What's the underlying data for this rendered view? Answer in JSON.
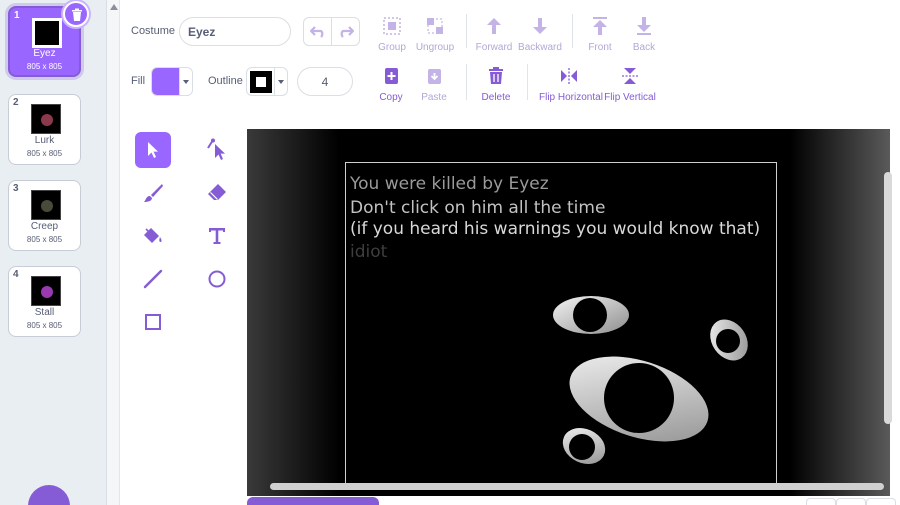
{
  "costumes": [
    {
      "number": "1",
      "name": "Eyez",
      "size": "805 x 805",
      "blob_color": "#6a6a6a"
    },
    {
      "number": "2",
      "name": "Lurk",
      "size": "805 x 805",
      "blob_color": "#8a3a4a"
    },
    {
      "number": "3",
      "name": "Creep",
      "size": "805 x 805",
      "blob_color": "#4a4a3a"
    },
    {
      "number": "4",
      "name": "Stall",
      "size": "805 x 805",
      "blob_color": "#9a3ab0"
    }
  ],
  "toolbar": {
    "costume_label": "Costume",
    "costume_name": "Eyez",
    "fill_label": "Fill",
    "fill_color": "#9966ff",
    "outline_label": "Outline",
    "outline_width": "4",
    "group": "Group",
    "ungroup": "Ungroup",
    "forward": "Forward",
    "backward": "Backward",
    "front": "Front",
    "back": "Back",
    "copy": "Copy",
    "paste": "Paste",
    "delete": "Delete",
    "flip_horizontal": "Flip Horizontal",
    "flip_vertical": "Flip Vertical"
  },
  "canvas": {
    "lines": [
      {
        "text": "You were killed by Eyez",
        "color": "#9a9a9a"
      },
      {
        "text": "Don't click on him all the time",
        "color": "#c2c2c2"
      },
      {
        "text": "(if you heard his warnings you would know that)",
        "color": "#d8d8d8"
      },
      {
        "text": "idiot",
        "color": "#3e3e3e"
      }
    ]
  },
  "colors": {
    "accent": "#855cd6",
    "accent_light": "#9966ff"
  }
}
